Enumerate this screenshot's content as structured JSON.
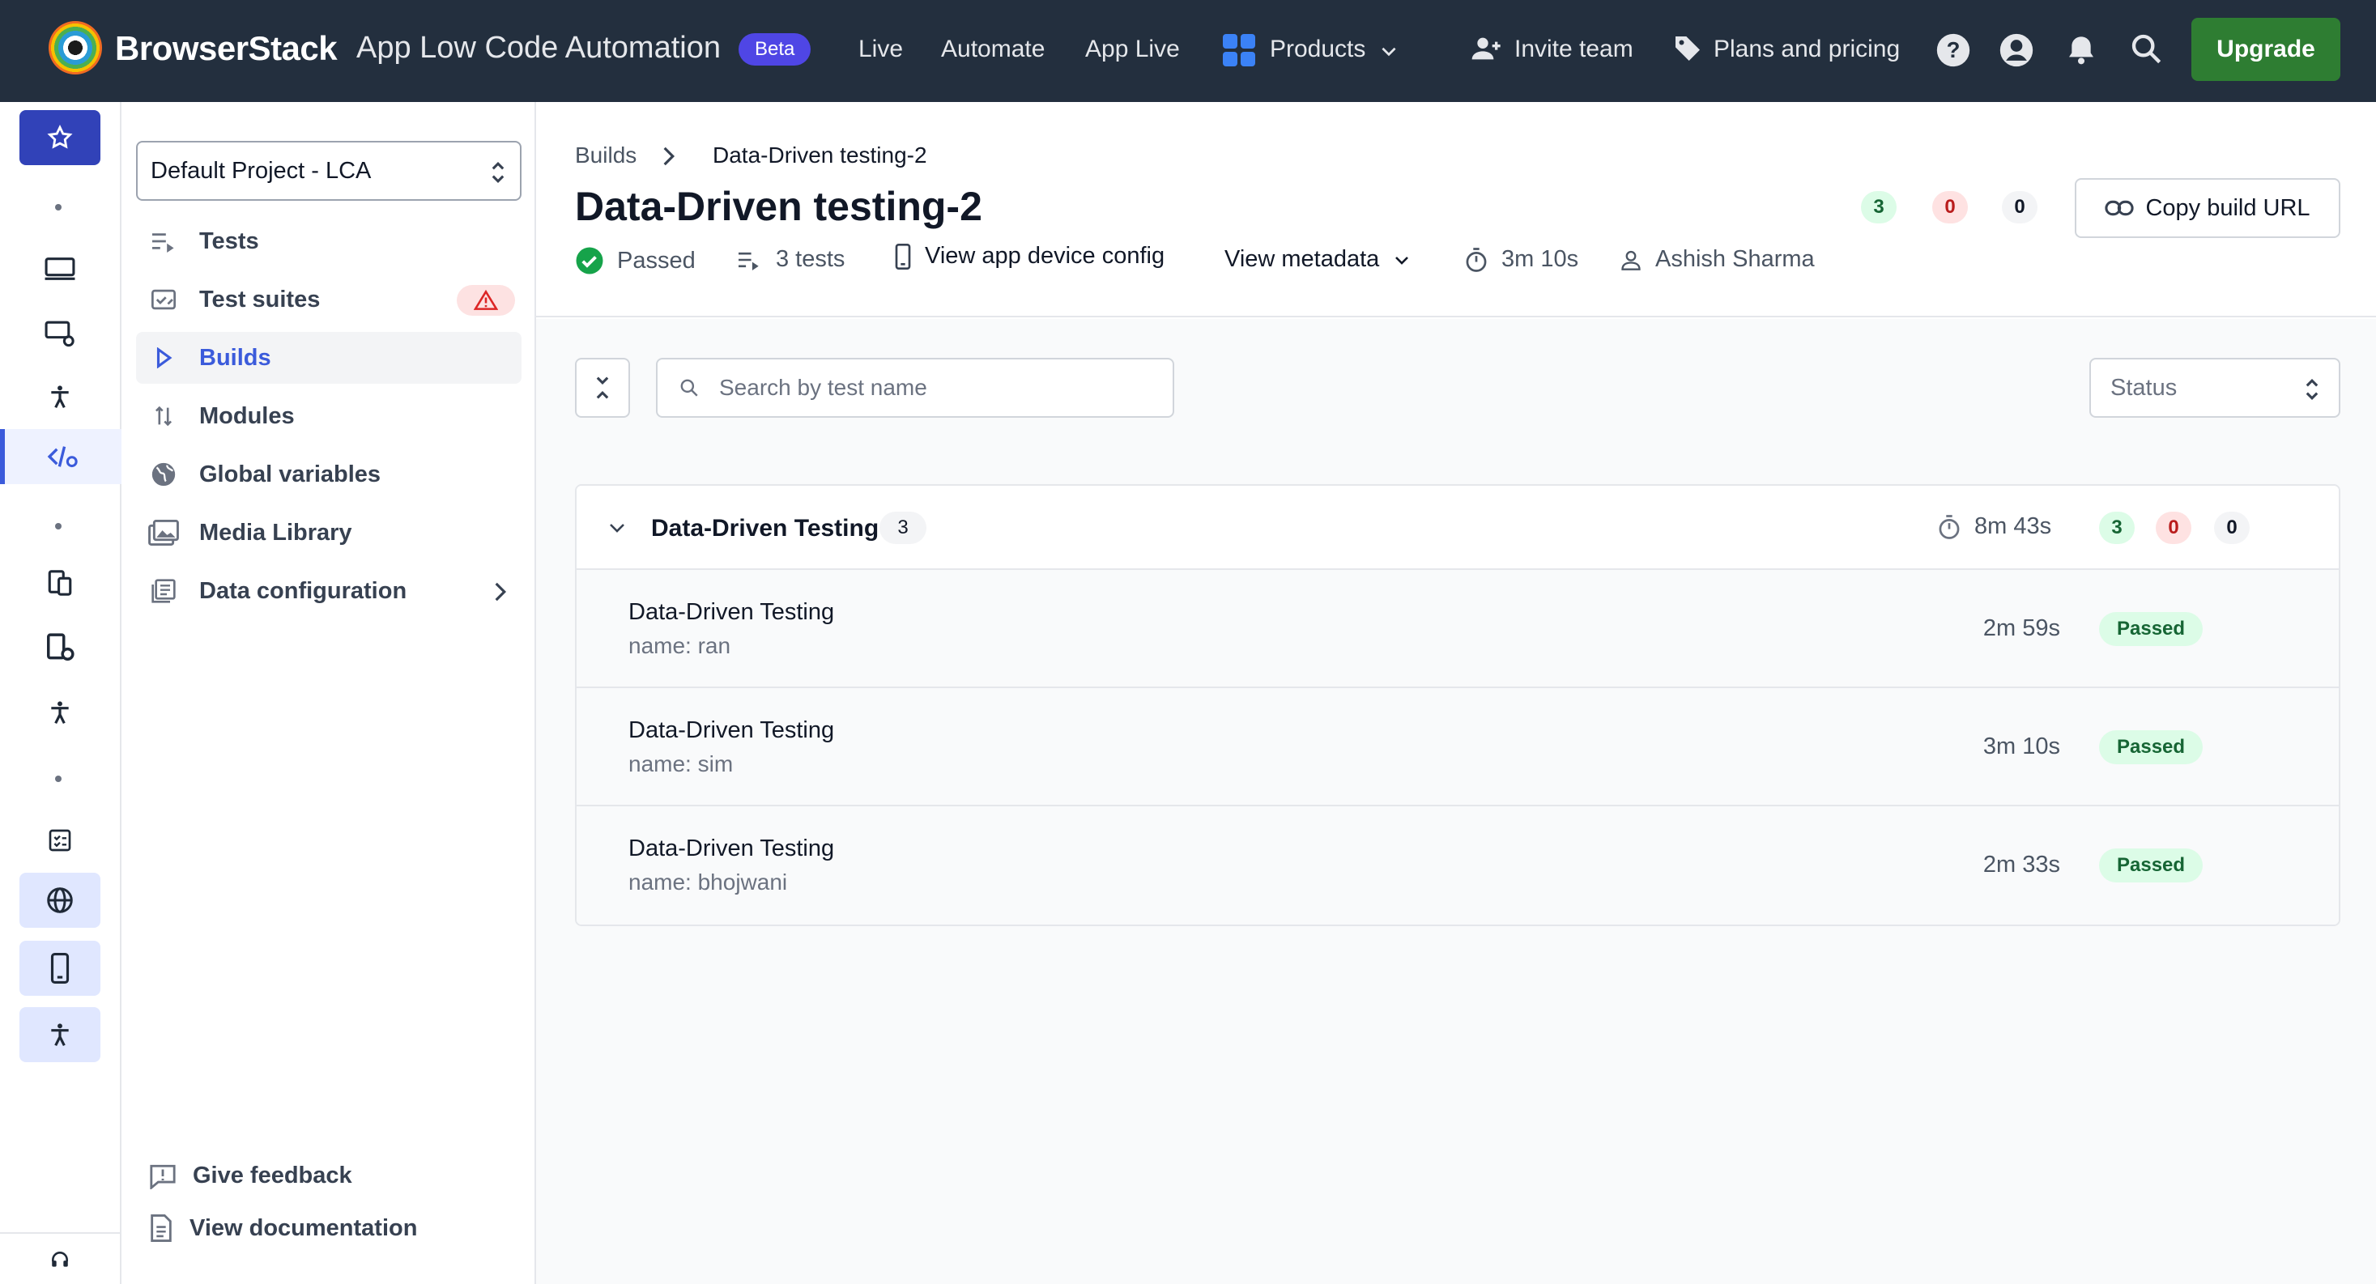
{
  "topbar": {
    "brand": "BrowserStack",
    "product": "App Low Code Automation",
    "beta": "Beta",
    "nav": [
      "Live",
      "Automate",
      "App Live"
    ],
    "products": "Products",
    "invite": "Invite team",
    "plans": "Plans and pricing",
    "upgrade": "Upgrade"
  },
  "sidebar": {
    "project": "Default Project - LCA",
    "items": [
      {
        "label": "Tests",
        "icon": "list-play-icon"
      },
      {
        "label": "Test suites",
        "icon": "suite-icon"
      },
      {
        "label": "Builds",
        "icon": "play-icon"
      },
      {
        "label": "Modules",
        "icon": "arrows-icon"
      },
      {
        "label": "Global variables",
        "icon": "globe-icon"
      },
      {
        "label": "Media Library",
        "icon": "image-icon"
      },
      {
        "label": "Data configuration",
        "icon": "data-icon"
      }
    ],
    "feedback": "Give feedback",
    "docs": "View documentation"
  },
  "build": {
    "breadcrumb_root": "Builds",
    "breadcrumb_current": "Data-Driven testing-2",
    "title": "Data-Driven testing-2",
    "status": "Passed",
    "tests": "3 tests",
    "device_config": "View app device config",
    "metadata": "View metadata",
    "duration": "3m 10s",
    "user": "Ashish Sharma",
    "counts": {
      "passed": "3",
      "failed": "0",
      "other": "0"
    },
    "copy_url": "Copy build URL"
  },
  "filters": {
    "search_placeholder": "Search by test name",
    "status": "Status"
  },
  "group": {
    "name": "Data-Driven Testing",
    "count": "3",
    "duration": "8m 43s",
    "counts": {
      "passed": "3",
      "failed": "0",
      "other": "0"
    },
    "rows": [
      {
        "name": "Data-Driven Testing",
        "sub": "name: ran",
        "duration": "2m 59s",
        "status": "Passed"
      },
      {
        "name": "Data-Driven Testing",
        "sub": "name: sim",
        "duration": "3m 10s",
        "status": "Passed"
      },
      {
        "name": "Data-Driven Testing",
        "sub": "name: bhojwani",
        "duration": "2m 33s",
        "status": "Passed"
      }
    ]
  },
  "colors": {
    "topbar": "#232f3e",
    "accent": "#3b5bdb",
    "upgrade": "#2e7d32",
    "beta": "#4f46e5"
  }
}
